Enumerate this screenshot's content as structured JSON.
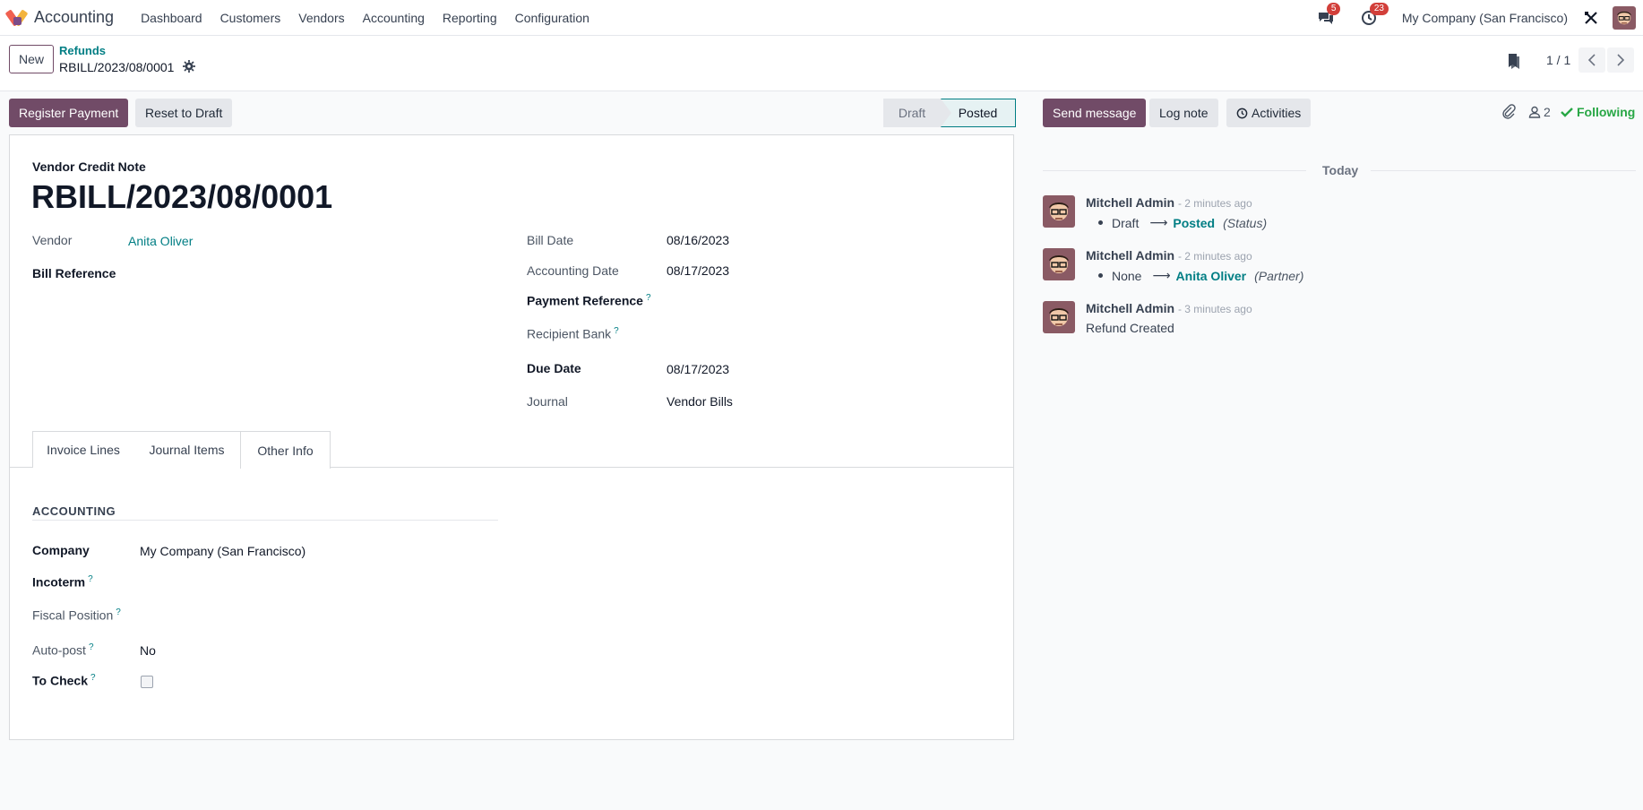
{
  "navbar": {
    "app_name": "Accounting",
    "menu": [
      "Dashboard",
      "Customers",
      "Vendors",
      "Accounting",
      "Reporting",
      "Configuration"
    ],
    "messages_count": "5",
    "activities_count": "23",
    "company": "My Company (San Francisco)"
  },
  "control_panel": {
    "new_label": "New",
    "breadcrumb_parent": "Refunds",
    "breadcrumb_current": "RBILL/2023/08/0001",
    "pager": "1 / 1"
  },
  "actions": {
    "register_payment": "Register Payment",
    "reset_to_draft": "Reset to Draft"
  },
  "status": {
    "steps": [
      "Draft",
      "Posted"
    ],
    "current": "Posted"
  },
  "form": {
    "doc_type": "Vendor Credit Note",
    "doc_number": "RBILL/2023/08/0001",
    "left": {
      "vendor_label": "Vendor",
      "vendor_value": "Anita Oliver",
      "bill_reference_label": "Bill Reference"
    },
    "right": {
      "bill_date_label": "Bill Date",
      "bill_date_value": "08/16/2023",
      "accounting_date_label": "Accounting Date",
      "accounting_date_value": "08/17/2023",
      "payment_reference_label": "Payment Reference",
      "recipient_bank_label": "Recipient Bank",
      "due_date_label": "Due Date",
      "due_date_value": "08/17/2023",
      "journal_label": "Journal",
      "journal_value": "Vendor Bills"
    },
    "tabs": [
      "Invoice Lines",
      "Journal Items",
      "Other Info"
    ],
    "active_tab": "Other Info",
    "other_info": {
      "section_title": "ACCOUNTING",
      "company_label": "Company",
      "company_value": "My Company (San Francisco)",
      "incoterm_label": "Incoterm",
      "fiscal_position_label": "Fiscal Position",
      "auto_post_label": "Auto-post",
      "auto_post_value": "No",
      "to_check_label": "To Check",
      "to_check_value": false
    }
  },
  "chatter": {
    "send_message": "Send message",
    "log_note": "Log note",
    "activities": "Activities",
    "followers_count": "2",
    "following": "Following",
    "today": "Today",
    "messages": [
      {
        "author": "Mitchell Admin",
        "time": "- 2 minutes ago",
        "old": "Draft",
        "new": "Posted",
        "field": "(Status)"
      },
      {
        "author": "Mitchell Admin",
        "time": "- 2 minutes ago",
        "old": "None",
        "new": "Anita Oliver",
        "field": "(Partner)"
      },
      {
        "author": "Mitchell Admin",
        "time": "- 3 minutes ago",
        "body": "Refund Created"
      }
    ]
  },
  "help_mark": "?"
}
